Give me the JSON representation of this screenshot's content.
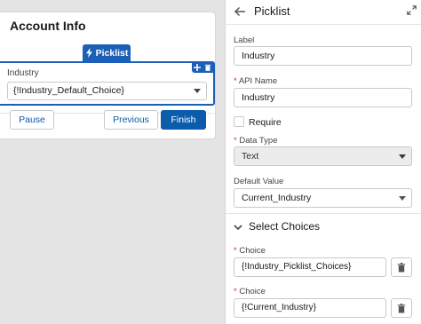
{
  "canvas": {
    "screen_title": "Account Info",
    "component_badge": "Picklist",
    "field": {
      "label": "Industry",
      "value": "{!Industry_Default_Choice}"
    },
    "buttons": {
      "pause": "Pause",
      "previous": "Previous",
      "finish": "Finish"
    }
  },
  "panel": {
    "title": "Picklist",
    "label_field": {
      "label": "Label",
      "value": "Industry"
    },
    "api_name_field": {
      "required_mark": "*",
      "label": "API Name",
      "value": "Industry"
    },
    "require_checkbox": {
      "label": "Require",
      "checked": false
    },
    "data_type_field": {
      "required_mark": "*",
      "label": "Data Type",
      "value": "Text"
    },
    "default_value_field": {
      "label": "Default Value",
      "value": "Current_Industry"
    },
    "select_choices": {
      "title": "Select Choices",
      "choices": [
        {
          "required_mark": "*",
          "label": "Choice",
          "value": "{!Industry_Picklist_Choices}"
        },
        {
          "required_mark": "*",
          "label": "Choice",
          "value": "{!Current_Industry}"
        }
      ]
    }
  },
  "colors": {
    "brand_blue": "#1b5fb6",
    "button_blue": "#0b5cab",
    "required_red": "#c23934",
    "canvas_bg": "#e4e4e4"
  },
  "icons": [
    "lightning-icon",
    "move-icon",
    "trash-icon",
    "back-arrow-icon",
    "expand-icon",
    "chevron-down-icon"
  ]
}
